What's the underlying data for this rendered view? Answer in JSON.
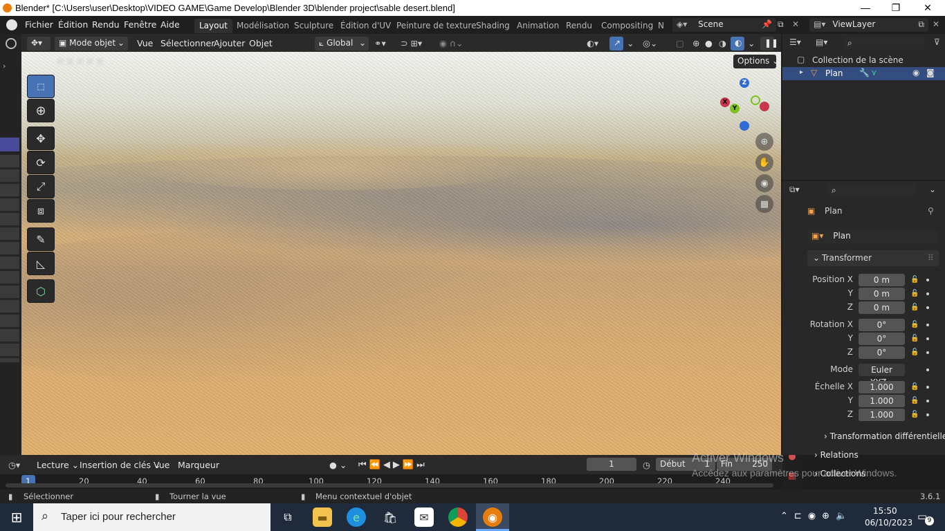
{
  "window": {
    "title": "Blender* [C:\\Users\\user\\Desktop\\VIDEO GAME\\Game Develop\\Blender 3D\\blender project\\sable desert.blend]",
    "minimize": "—",
    "maximize": "❐",
    "close": "✕"
  },
  "menu": {
    "items": [
      "Fichier",
      "Édition",
      "Rendu",
      "Fenêtre",
      "Aide"
    ],
    "workspaces": [
      "Layout",
      "Modélisation",
      "Sculpture",
      "Édition d'UV",
      "Peinture de texture",
      "Shading",
      "Animation",
      "Rendu",
      "Compositing",
      "N"
    ],
    "active_workspace": "Layout",
    "scene": "Scene",
    "view_layer": "ViewLayer"
  },
  "viewport_header": {
    "mode": "Mode objet",
    "menus": [
      "Vue",
      "Sélectionner",
      "Ajouter",
      "Objet"
    ],
    "orientation": "Global",
    "options": "Options"
  },
  "outliner": {
    "collection": "Collection de la scène",
    "object": "Plan"
  },
  "properties": {
    "object_name": "Plan",
    "data_name": "Plan",
    "transform_header": "Transformer",
    "position_label": "Position X",
    "rotation_label": "Rotation X",
    "scale_label": "Échelle X",
    "y_label": "Y",
    "z_label": "Z",
    "mode_label": "Mode",
    "mode_value": "Euler XYZ",
    "position": [
      "0 m",
      "0 m",
      "0 m"
    ],
    "rotation": [
      "0°",
      "0°",
      "0°"
    ],
    "scale": [
      "1.000",
      "1.000",
      "1.000"
    ],
    "delta_transform": "Transformation différentielle",
    "relations": "Relations",
    "collections": "Collections"
  },
  "timeline": {
    "menus": [
      "Lecture",
      "Insertion de clés",
      "Vue",
      "Marqueur"
    ],
    "current_frame": "1",
    "start_label": "Début",
    "start": "1",
    "end_label": "Fin",
    "end": "250",
    "ruler": [
      "1",
      "20",
      "40",
      "60",
      "80",
      "100",
      "120",
      "140",
      "160",
      "180",
      "200",
      "220",
      "240"
    ]
  },
  "statusbar": {
    "select": "Sélectionner",
    "rotate": "Tourner la vue",
    "context": "Menu contextuel d'objet",
    "version": "3.6.1"
  },
  "watermark": {
    "line1": "Activer Windows",
    "line2": "Accédez aux paramètres pour activer Windows."
  },
  "taskbar": {
    "search_placeholder": "Taper ici pour rechercher",
    "time": "15:50",
    "date": "06/10/2023",
    "notifications": "9"
  },
  "colors": {
    "accent_blue": "#4772b3",
    "blender_orange": "#e87d0d",
    "axis_x": "#c8374b",
    "axis_y": "#7dc21e",
    "axis_z": "#2e6bd6"
  }
}
